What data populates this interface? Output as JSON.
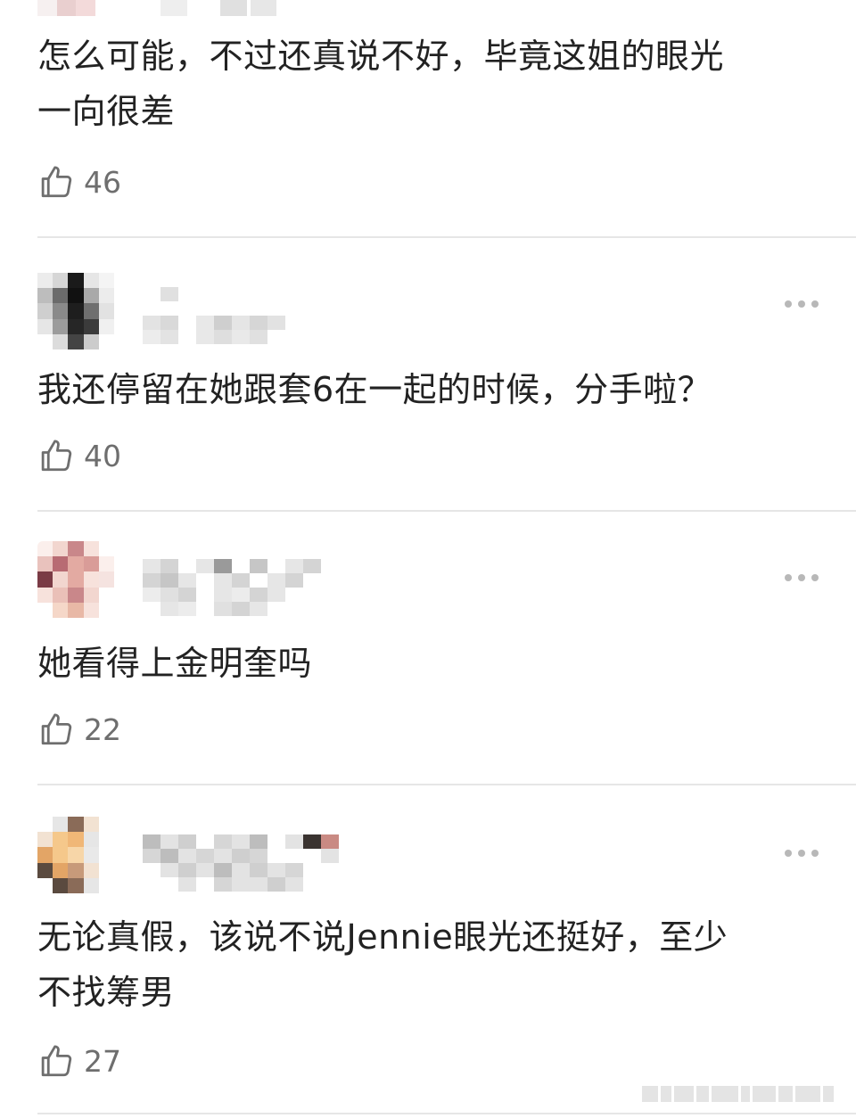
{
  "comments": [
    {
      "text_line1": "怎么可能，不过还真说不好，毕竟这姐的眼光",
      "text_line2": "一向很差",
      "likes": "46",
      "avatar_colors": [
        "#ffffff",
        "#f3e0e0",
        "#e8c8c8",
        "#f6e9e9",
        "#ffffff"
      ],
      "name_colors": [
        "#efefef",
        "#e3e3e3",
        "#d8d8d8"
      ]
    },
    {
      "text_line1": "我还停留在她跟套6在一起的时候，分手啦？",
      "likes": "40",
      "avatar_colors": [
        "#d6d6d6",
        "#6b6b6b",
        "#1a1a1a",
        "#3b3b3b",
        "#a9a9a9",
        "#ececec"
      ],
      "name_colors": [
        "#d9d9d9",
        "#cfcfcf",
        "#e5e5e5"
      ]
    },
    {
      "text_line1": "她看得上金明奎吗",
      "likes": "22",
      "avatar_colors": [
        "#f2d6cf",
        "#b86b73",
        "#e3aaa2",
        "#7a3b45",
        "#f7e2dc",
        "#c9878a"
      ],
      "name_colors": [
        "#d4d4d4",
        "#c6c6c6",
        "#e6e6e6",
        "#9a9a9a"
      ]
    },
    {
      "text_line1": "无论真假，该说不说Jennie眼光还挺好，至少",
      "text_line2": "不找筹男",
      "likes": "27",
      "avatar_colors": [
        "#f5c88b",
        "#e3a566",
        "#5a4a3f",
        "#f2e2d2",
        "#c79a7a",
        "#8a6b58"
      ],
      "name_colors": [
        "#cfcfcf",
        "#bdbdbd",
        "#3a3330",
        "#c98a83",
        "#e3e3e3"
      ]
    }
  ],
  "icons": {
    "like": "thumbs-up-icon",
    "more": "more-horizontal-icon"
  },
  "colors": {
    "text": "#222222",
    "muted": "#6e6e6e",
    "divider": "#e6e6e6"
  }
}
